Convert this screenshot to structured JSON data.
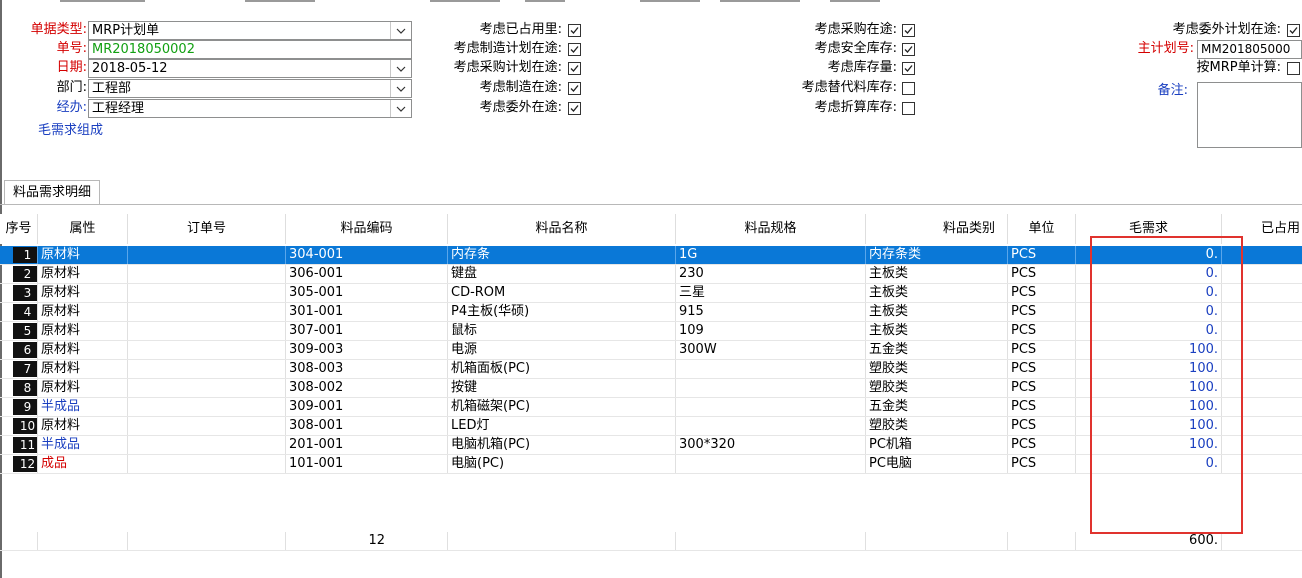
{
  "form": {
    "doc_type": {
      "label": "单据类型:",
      "value": "MRP计划单"
    },
    "doc_no": {
      "label": "单号:",
      "value": "MR2018050002"
    },
    "date": {
      "label": "日期:",
      "value": "2018-05-12"
    },
    "dept": {
      "label": "部门:",
      "value": "工程部"
    },
    "handler": {
      "label": "经办:",
      "value": "工程经理"
    },
    "gross_link": "毛需求组成"
  },
  "options": [
    {
      "label": "考虑已占用里:",
      "checked": true
    },
    {
      "label": "考虑制造计划在途:",
      "checked": true
    },
    {
      "label": "考虑采购计划在途:",
      "checked": true
    },
    {
      "label": "考虑制造在途:",
      "checked": true
    },
    {
      "label": "考虑委外在途:",
      "checked": true
    },
    {
      "label": "考虑采购在途:",
      "checked": true
    },
    {
      "label": "考虑安全库存:",
      "checked": true
    },
    {
      "label": "考虑库存量:",
      "checked": true
    },
    {
      "label": "考虑替代料库存:",
      "checked": false
    },
    {
      "label": "考虑折算库存:",
      "checked": false
    },
    {
      "label": "考虑委外计划在途:",
      "checked": true
    }
  ],
  "right_panel": {
    "master_plan": {
      "label": "主计划号:",
      "value": "MM201805000"
    },
    "by_mrp": {
      "label": "按MRP单计算:",
      "checked": false
    },
    "remark": {
      "label": "备注:",
      "value": ""
    }
  },
  "tab": {
    "label": "料品需求明细"
  },
  "table": {
    "headers": [
      "序号",
      "属性",
      "订单号",
      "料品编码",
      "料品名称",
      "料品规格",
      "料品类别",
      "单位",
      "毛需求",
      "已占用"
    ],
    "rows": [
      {
        "no": "1",
        "attr": "原材料",
        "order": "",
        "code": "304-001",
        "name": "内存条",
        "spec": "1G",
        "cat": "内存条类",
        "unit": "PCS",
        "gross": "0."
      },
      {
        "no": "2",
        "attr": "原材料",
        "order": "",
        "code": "306-001",
        "name": "键盘",
        "spec": "230",
        "cat": "主板类",
        "unit": "PCS",
        "gross": "0."
      },
      {
        "no": "3",
        "attr": "原材料",
        "order": "",
        "code": "305-001",
        "name": "CD-ROM",
        "spec": "三星",
        "cat": "主板类",
        "unit": "PCS",
        "gross": "0."
      },
      {
        "no": "4",
        "attr": "原材料",
        "order": "",
        "code": "301-001",
        "name": "P4主板(华硕)",
        "spec": "915",
        "cat": "主板类",
        "unit": "PCS",
        "gross": "0."
      },
      {
        "no": "5",
        "attr": "原材料",
        "order": "",
        "code": "307-001",
        "name": "鼠标",
        "spec": "109",
        "cat": "主板类",
        "unit": "PCS",
        "gross": "0."
      },
      {
        "no": "6",
        "attr": "原材料",
        "order": "",
        "code": "309-003",
        "name": "电源",
        "spec": "300W",
        "cat": "五金类",
        "unit": "PCS",
        "gross": "100."
      },
      {
        "no": "7",
        "attr": "原材料",
        "order": "",
        "code": "308-003",
        "name": "机箱面板(PC)",
        "spec": "",
        "cat": "塑胶类",
        "unit": "PCS",
        "gross": "100."
      },
      {
        "no": "8",
        "attr": "原材料",
        "order": "",
        "code": "308-002",
        "name": "按键",
        "spec": "",
        "cat": "塑胶类",
        "unit": "PCS",
        "gross": "100."
      },
      {
        "no": "9",
        "attr": "半成品",
        "order": "",
        "code": "309-001",
        "name": "机箱磁架(PC)",
        "spec": "",
        "cat": "五金类",
        "unit": "PCS",
        "gross": "100."
      },
      {
        "no": "10",
        "attr": "原材料",
        "order": "",
        "code": "308-001",
        "name": "LED灯",
        "spec": "",
        "cat": "塑胶类",
        "unit": "PCS",
        "gross": "100."
      },
      {
        "no": "11",
        "attr": "半成品",
        "order": "",
        "code": "201-001",
        "name": "电脑机箱(PC)",
        "spec": "300*320",
        "cat": "PC机箱",
        "unit": "PCS",
        "gross": "100."
      },
      {
        "no": "12",
        "attr": "成品",
        "order": "",
        "code": "101-001",
        "name": "电脑(PC)",
        "spec": "",
        "cat": "PC电脑",
        "unit": "PCS",
        "gross": "0."
      }
    ],
    "footer": {
      "count": "12",
      "gross_total": "600."
    }
  },
  "colors": {
    "selection": "#0a78d7",
    "highlight_box": "#e0332e",
    "label_red": "#d40000",
    "label_blue": "#1a3fc0",
    "value_green": "#12a012"
  },
  "icons": {
    "dropdown": "chevron-down-icon",
    "check": "check-icon"
  }
}
